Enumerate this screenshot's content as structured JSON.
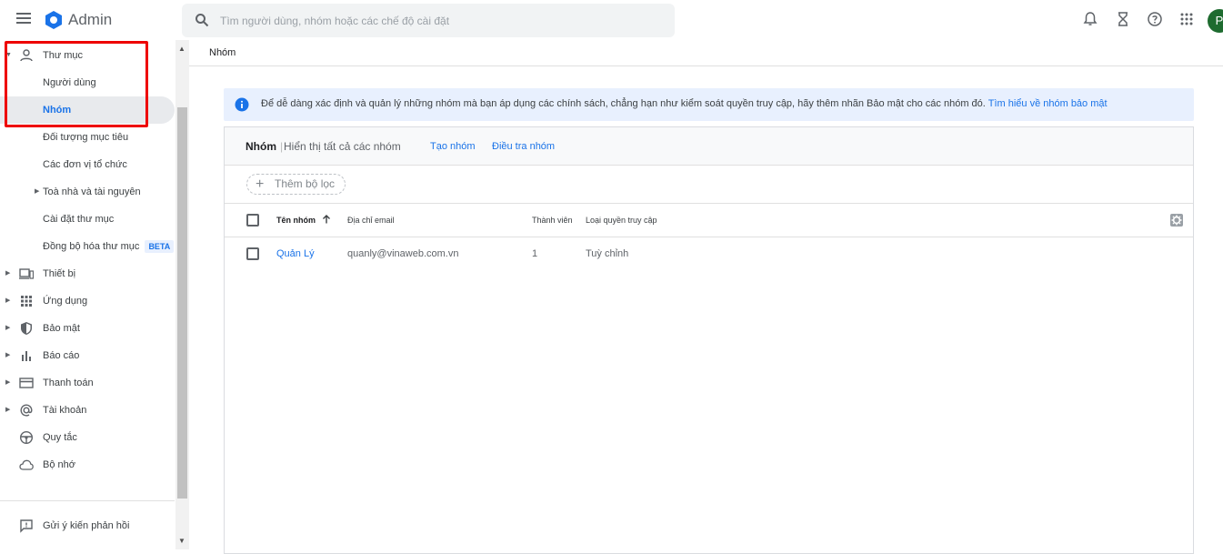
{
  "header": {
    "app_title": "Admin",
    "search_placeholder": "Tìm người dùng, nhóm hoặc các chế độ cài đặt",
    "avatar_letter": "P"
  },
  "sidebar": {
    "items": [
      {
        "label": "Thư mục",
        "icon": "person-icon",
        "caret": "down"
      },
      {
        "label": "Người dùng"
      },
      {
        "label": "Nhóm",
        "active": true
      },
      {
        "label": "Đối tượng mục tiêu"
      },
      {
        "label": "Các đơn vị tổ chức"
      },
      {
        "label": "Toà nhà và tài nguyên",
        "caret": "right"
      },
      {
        "label": "Cài đặt thư mục"
      },
      {
        "label": "Đồng bộ hóa thư mục",
        "badge": "BETA"
      },
      {
        "label": "Thiết bị",
        "icon": "devices-icon",
        "caret": "right"
      },
      {
        "label": "Ứng dụng",
        "icon": "apps-grid-icon",
        "caret": "right"
      },
      {
        "label": "Bảo mật",
        "icon": "shield-icon",
        "caret": "right"
      },
      {
        "label": "Báo cáo",
        "icon": "bar-chart-icon",
        "caret": "right"
      },
      {
        "label": "Thanh toán",
        "icon": "credit-card-icon",
        "caret": "right"
      },
      {
        "label": "Tài khoản",
        "icon": "at-sign-icon",
        "caret": "right"
      },
      {
        "label": "Quy tắc",
        "icon": "steering-wheel-icon"
      },
      {
        "label": "Bộ nhớ",
        "icon": "cloud-icon"
      }
    ],
    "feedback": "Gửi ý kiến phản hồi"
  },
  "breadcrumb": "Nhóm",
  "banner": {
    "text": "Để dễ dàng xác định và quản lý những nhóm mà bạn áp dụng các chính sách, chẳng hạn như kiểm soát quyền truy cập, hãy thêm nhãn Bảo mật cho các nhóm đó.",
    "link": "Tìm hiểu về nhóm bảo mật"
  },
  "card": {
    "title": "Nhóm",
    "separator": "|",
    "subtitle": "Hiển thị tất cả các nhóm",
    "create_link": "Tạo nhóm",
    "investigate_link": "Điều tra nhóm",
    "add_filter": "Thêm bộ lọc"
  },
  "table": {
    "columns": [
      "Tên nhóm",
      "Địa chỉ email",
      "Thành viên",
      "Loại quyền truy cập"
    ],
    "rows": [
      {
        "name": "Quản Lý",
        "email": "quanly@vinaweb.com.vn",
        "members": "1",
        "access": "Tuỳ chỉnh"
      }
    ]
  },
  "colors": {
    "accent": "#1a73e8",
    "highlight_box": "#ee0000",
    "banner_bg": "#e8f0fe"
  }
}
